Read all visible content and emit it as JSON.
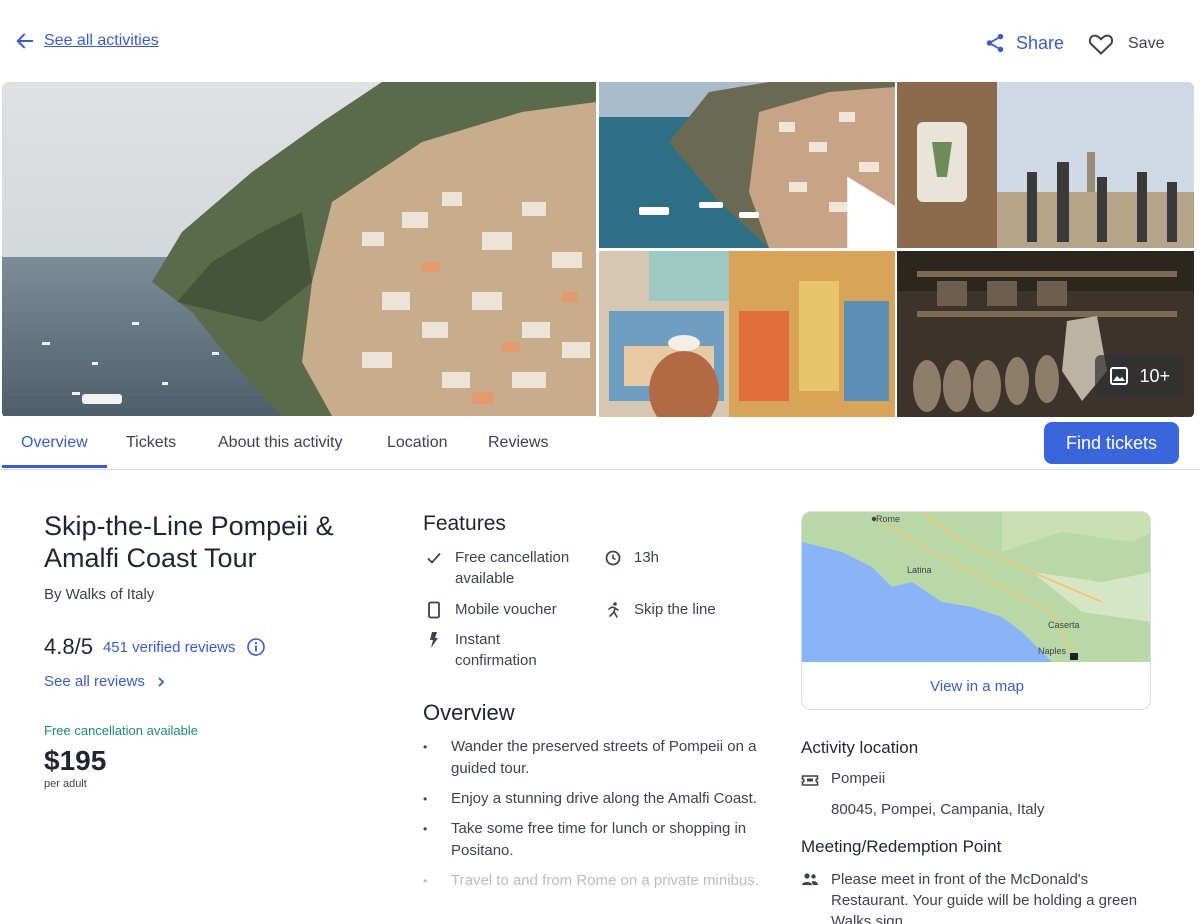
{
  "nav": {
    "back_label": "See all activities",
    "share_label": "Share",
    "save_label": "Save"
  },
  "gallery": {
    "more_label": "10+"
  },
  "tabs": [
    {
      "label": "Overview",
      "active": true
    },
    {
      "label": "Tickets",
      "active": false
    },
    {
      "label": "About this activity",
      "active": false
    },
    {
      "label": "Location",
      "active": false
    },
    {
      "label": "Reviews",
      "active": false
    }
  ],
  "find_tickets_label": "Find tickets",
  "activity": {
    "title": "Skip-the-Line Pompeii & Amalfi Coast Tour",
    "byline": "By Walks of Italy",
    "rating": "4.8/5",
    "reviews_count": "451 verified reviews",
    "see_all_reviews": "See all reviews",
    "free_cancellation": "Free cancellation available",
    "price": "$195",
    "price_unit": "per adult"
  },
  "features": {
    "heading": "Features",
    "items": [
      {
        "icon": "check-icon",
        "text": "Free cancellation available"
      },
      {
        "icon": "clock-icon",
        "text": "13h"
      },
      {
        "icon": "phone-icon",
        "text": "Mobile voucher"
      },
      {
        "icon": "runner-icon",
        "text": "Skip the line"
      },
      {
        "icon": "bolt-icon",
        "text": "Instant confirmation"
      }
    ]
  },
  "overview": {
    "heading": "Overview",
    "bullets": [
      "Wander the preserved streets of Pompeii on a guided tour.",
      "Enjoy a stunning drive along the Amalfi Coast.",
      "Take some free time for lunch or shopping in Positano.",
      "Travel to and from Rome on a private minibus."
    ]
  },
  "map": {
    "view_label": "View in a map",
    "labels": [
      "Rome",
      "Latina",
      "Caserta",
      "Naples"
    ]
  },
  "location": {
    "heading": "Activity location",
    "place": "Pompeii",
    "address": "80045, Pompei, Campania, Italy"
  },
  "meeting": {
    "heading": "Meeting/Redemption Point",
    "text": "Please meet in front of the McDonald's Restaurant. Your guide will be holding a green Walks sign."
  },
  "colors": {
    "accent": "#3b5cc4",
    "button": "#3b66db",
    "free_cancel": "#1e8a6e",
    "text": "#1f2533"
  }
}
